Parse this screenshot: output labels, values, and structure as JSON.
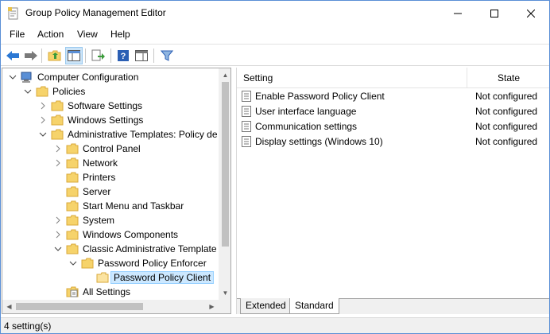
{
  "window": {
    "title": "Group Policy Management Editor"
  },
  "menu": [
    "File",
    "Action",
    "View",
    "Help"
  ],
  "toolbar": {
    "buttons": [
      "back-arrow-icon",
      "forward-arrow-icon",
      "up-folder-icon",
      "show-hide-tree-icon",
      "export-list-icon",
      "help-icon",
      "properties-pane-icon",
      "filter-icon"
    ]
  },
  "tree": {
    "items": [
      {
        "label": "Computer Configuration",
        "expanded": true
      },
      {
        "label": "Policies",
        "expanded": true
      },
      {
        "label": "Software Settings",
        "expanded": false
      },
      {
        "label": "Windows Settings",
        "expanded": false
      },
      {
        "label": "Administrative Templates: Policy de",
        "expanded": true
      },
      {
        "label": "Control Panel",
        "expanded": false
      },
      {
        "label": "Network",
        "expanded": false
      },
      {
        "label": "Printers"
      },
      {
        "label": "Server"
      },
      {
        "label": "Start Menu and Taskbar"
      },
      {
        "label": "System",
        "expanded": false
      },
      {
        "label": "Windows Components",
        "expanded": false
      },
      {
        "label": "Classic Administrative Template",
        "expanded": true
      },
      {
        "label": "Password Policy Enforcer",
        "expanded": true
      },
      {
        "label": "Password Policy Client",
        "selected": true
      },
      {
        "label": "All Settings"
      }
    ]
  },
  "list": {
    "columns": {
      "setting": "Setting",
      "state": "State"
    },
    "rows": [
      {
        "name": "Enable Password Policy Client",
        "state": "Not configured"
      },
      {
        "name": "User interface language",
        "state": "Not configured"
      },
      {
        "name": "Communication settings",
        "state": "Not configured"
      },
      {
        "name": "Display settings (Windows 10)",
        "state": "Not configured"
      }
    ]
  },
  "tabs": {
    "extended": "Extended",
    "standard": "Standard"
  },
  "status": {
    "text": "4 setting(s)"
  },
  "colors": {
    "folder": "#f6d36b",
    "folder_edge": "#d9a93a",
    "selection": "#cce8ff",
    "accent": "#2b78d4"
  }
}
